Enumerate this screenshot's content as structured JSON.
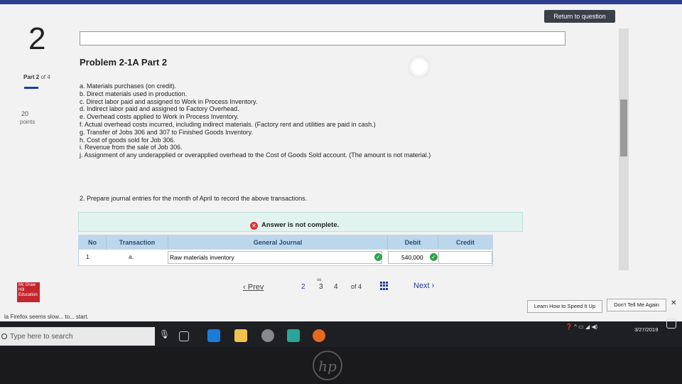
{
  "header": {
    "return_label": "Return to question",
    "question_number": "2"
  },
  "sidebar": {
    "part_label": "Part 2",
    "part_of": "of 4",
    "points_value": "20",
    "points_label": "points"
  },
  "problem": {
    "title": "Problem 2-1A Part 2",
    "transactions": [
      "a. Materials purchases (on credit).",
      "b. Direct materials used in production.",
      "c. Direct labor paid and assigned to Work in Process Inventory.",
      "d. Indirect labor paid and assigned to Factory Overhead.",
      "e. Overhead costs applied to Work in Process Inventory.",
      "f. Actual overhead costs incurred, including indirect materials. (Factory rent and utilities are paid in cash.)",
      "g. Transfer of Jobs 306 and 307 to Finished Goods Inventory.",
      "h. Cost of goods sold for Job 306.",
      "i. Revenue from the sale of Job 306.",
      "j. Assignment of any underapplied or overapplied overhead to the Cost of Goods Sold account. (The amount is not material.)"
    ],
    "instruction": "2. Prepare journal entries for the month of April to record the above transactions."
  },
  "answer": {
    "status": "Answer is not complete."
  },
  "journal": {
    "headers": {
      "no": "No",
      "transaction": "Transaction",
      "general_journal": "General Journal",
      "debit": "Debit",
      "credit": "Credit"
    },
    "rows": [
      {
        "no": "1",
        "transaction": "a.",
        "account": "Raw materials inventory",
        "debit": "540,000",
        "credit": ""
      }
    ]
  },
  "pagination": {
    "prev_label": "Prev",
    "pages": [
      "2",
      "3",
      "4"
    ],
    "of_label": "of 4",
    "next_label": "Next"
  },
  "logo": {
    "text": "Mc Graw Hill Education"
  },
  "notification": {
    "text": "la Firefox seems slow... to... start.",
    "learn_label": "Learn How to Speed It Up",
    "dont_label": "Don't Tell Me Again"
  },
  "taskbar": {
    "search_placeholder": "Type here to search",
    "time": "7:49 PM",
    "date": "3/27/2019"
  }
}
